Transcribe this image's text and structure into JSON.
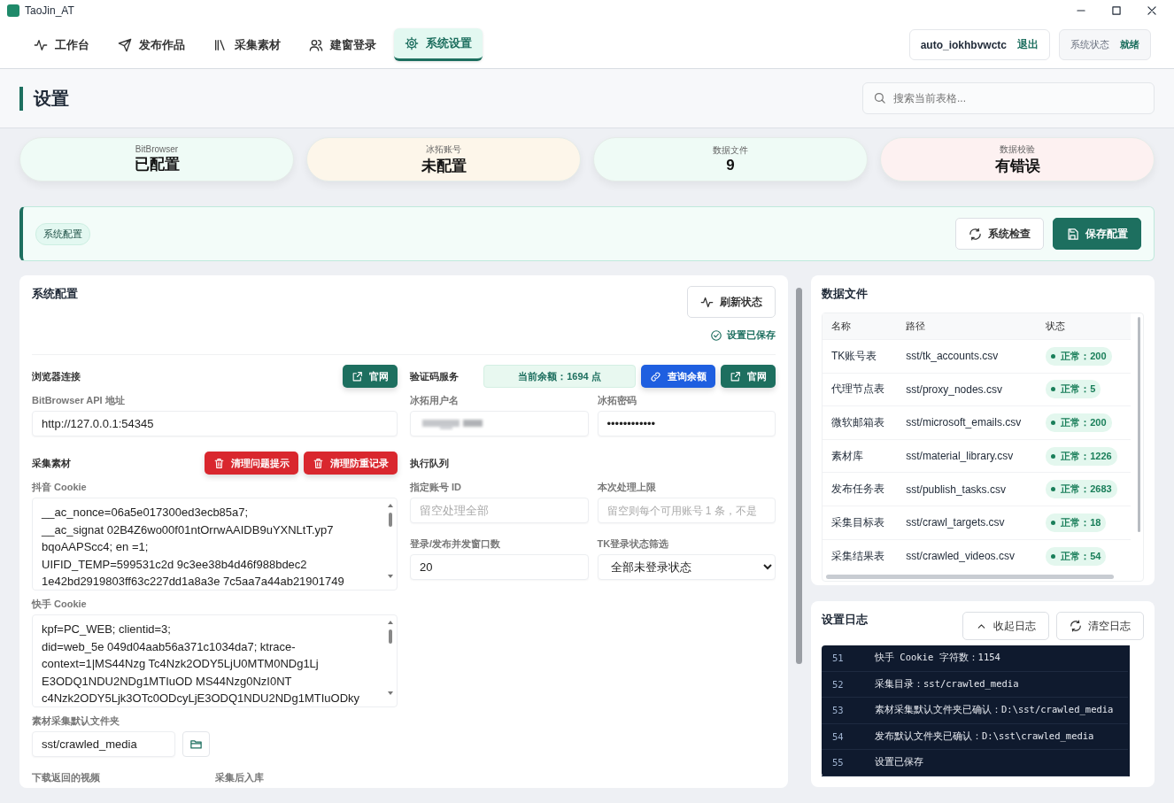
{
  "window": {
    "title": "TaoJin_AT"
  },
  "nav": {
    "tabs": [
      {
        "label": "工作台",
        "selected": false
      },
      {
        "label": "发布作品",
        "selected": false
      },
      {
        "label": "采集素材",
        "selected": false
      },
      {
        "label": "建窗登录",
        "selected": false
      },
      {
        "label": "系统设置",
        "selected": true
      }
    ],
    "user": {
      "name": "auto_iokhbvwctc",
      "logout": "退出"
    },
    "status": {
      "label": "系统状态",
      "value": "就绪"
    }
  },
  "page": {
    "title": "设置",
    "search": {
      "placeholder": "搜索当前表格..."
    }
  },
  "stats": [
    {
      "label": "BitBrowser",
      "value": "已配置",
      "color": "#effbf6"
    },
    {
      "label": "冰拓账号",
      "value": "未配置",
      "color": "#fdf6ea"
    },
    {
      "label": "数据文件",
      "value": "9",
      "color": "#effbf6"
    },
    {
      "label": "数据校验",
      "value": "有错误",
      "color": "#fdf1f1"
    }
  ],
  "banner": {
    "tag": "系统配置",
    "buttons": [
      {
        "label": "系统检查",
        "kind": "secondary"
      },
      {
        "label": "保存配置",
        "kind": "primary"
      }
    ]
  },
  "config": {
    "title": "系统配置",
    "refresh": "刷新状态",
    "saved": "设置已保存",
    "browser": {
      "heading": "浏览器连接",
      "link": "官网",
      "api_label": "BitBrowser API 地址",
      "api_value": "http://127.0.0.1:54345"
    },
    "collect": {
      "heading": "采集素材",
      "buttons": [
        "清理问题提示",
        "清理防重记录"
      ],
      "douyin_label": "抖音 Cookie",
      "douyin_lines": [
        "__ac_nonce=06a5e017300ed3ecb85a7;",
        "__ac_signat 02B4Z6wo00f01ntOrrwAAIDB9uYXNLtT.yp7",
        "bqoAAPScc4; en =1;",
        "UIFID_TEMP=599531c2d 9c3ee38b4d46f988bdec2",
        "1e42bd2919803ff63c227dd1a8a3e 7c5aa7a44ab21901749"
      ],
      "kuaishou_label": "快手 Cookie",
      "kuaishou_lines": [
        "kpf=PC_WEB; clientid=3;",
        "did=web_5e 049d04aab56a371c1034da7; ktrace-",
        "context=1|MS44Nzg Tc4Nzk2ODY5LjU0MTM0NDg1Lj",
        "E3ODQ1NDU2NDg1MTIuOD MS44Nzg0NzI0NT",
        "c4Nzk2ODY5Ljk3OTc0ODcyLjE3ODQ1NDU2NDg1MTIuODky"
      ],
      "folder_label": "素材采集默认文件夹",
      "folder_value": "sst/crawled_media",
      "bottom_labels": [
        "下载返回的视频",
        "采集后入库"
      ]
    },
    "captcha": {
      "heading": "验证码服务",
      "balance": "当前余额：1694 点",
      "query": "查询余额",
      "link": "官网",
      "user_label": "冰拓用户名",
      "password_label": "冰拓密码",
      "password_value": "••••••••••••"
    },
    "queue": {
      "heading": "执行队列",
      "account_label": "指定账号 ID",
      "account_placeholder": "留空处理全部",
      "limit_label": "本次处理上限",
      "limit_placeholder": "留空则每个可用账号 1 条，不是",
      "windows_label": "登录/发布并发窗口数",
      "windows_value": "20",
      "filter_label": "TK登录状态筛选",
      "filter_value": "全部未登录状态"
    }
  },
  "data_files": {
    "title": "数据文件",
    "columns": [
      "名称",
      "路径",
      "状态"
    ],
    "rows": [
      {
        "name": "TK账号表",
        "path": "sst/tk_accounts.csv",
        "status": "正常：200"
      },
      {
        "name": "代理节点表",
        "path": "sst/proxy_nodes.csv",
        "status": "正常：5"
      },
      {
        "name": "微软邮箱表",
        "path": "sst/microsoft_emails.csv",
        "status": "正常：200"
      },
      {
        "name": "素材库",
        "path": "sst/material_library.csv",
        "status": "正常：1226"
      },
      {
        "name": "发布任务表",
        "path": "sst/publish_tasks.csv",
        "status": "正常：2683"
      },
      {
        "name": "采集目标表",
        "path": "sst/crawl_targets.csv",
        "status": "正常：18"
      },
      {
        "name": "采集结果表",
        "path": "sst/crawled_videos.csv",
        "status": "正常：54"
      }
    ]
  },
  "log": {
    "title": "设置日志",
    "buttons": [
      "收起日志",
      "清空日志"
    ],
    "entries": [
      {
        "line": "51",
        "text": "快手 Cookie 字符数：1154"
      },
      {
        "line": "52",
        "text": "采集目录：sst/crawled_media"
      },
      {
        "line": "53",
        "text": "素材采集默认文件夹已确认：D:\\sst/crawled_media"
      },
      {
        "line": "54",
        "text": "发布默认文件夹已确认：D:\\sst\\crawled_media"
      },
      {
        "line": "55",
        "text": "设置已保存"
      }
    ]
  }
}
